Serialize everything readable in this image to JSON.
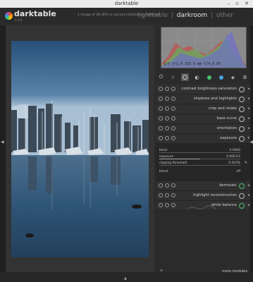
{
  "window": {
    "title": "darktable",
    "buttons": "– ▫ ✕"
  },
  "header": {
    "app_name": "darktable",
    "version": "2.4.0",
    "status": "1 image of 28 (#0) in current collection is selected",
    "views": {
      "lightable": "lighttable",
      "sep1": "|",
      "darkroom": "darkroom",
      "sep2": "|",
      "other": "other"
    }
  },
  "histogram": {
    "info": "1/f  f/1.0  ISO 0 mm  f/4.0  EV"
  },
  "modules": [
    {
      "name": "contrast brightness saturation"
    },
    {
      "name": "shadows and highlights"
    },
    {
      "name": "crop and rotate"
    },
    {
      "name": "base curve"
    },
    {
      "name": "orientation"
    },
    {
      "name": "exposure"
    },
    {
      "name": "demosaic"
    },
    {
      "name": "highlight reconstruction"
    },
    {
      "name": "white balance"
    }
  ],
  "exposure": {
    "black_label": "black",
    "black_value": "0.0000",
    "exposure_label": "exposure",
    "exposure_value": "0.000 EV",
    "clipping_label": "clipping threshold",
    "clipping_value": "0.010%",
    "blend_label": "blend",
    "blend_value": "off",
    "exposure_level": 0.5,
    "clipping_level": 0.0
  },
  "footer": {
    "more_modules": "more modules",
    "more_icon": "≡"
  },
  "arrows": {
    "left": "◀",
    "right": "◀",
    "bottom": "▲"
  },
  "colors": {
    "panel_bg": "#2b2b2b",
    "highlight": "#e5e5e5",
    "accent_green": "#4bbf6b",
    "accent_blue": "#4aa3df"
  }
}
